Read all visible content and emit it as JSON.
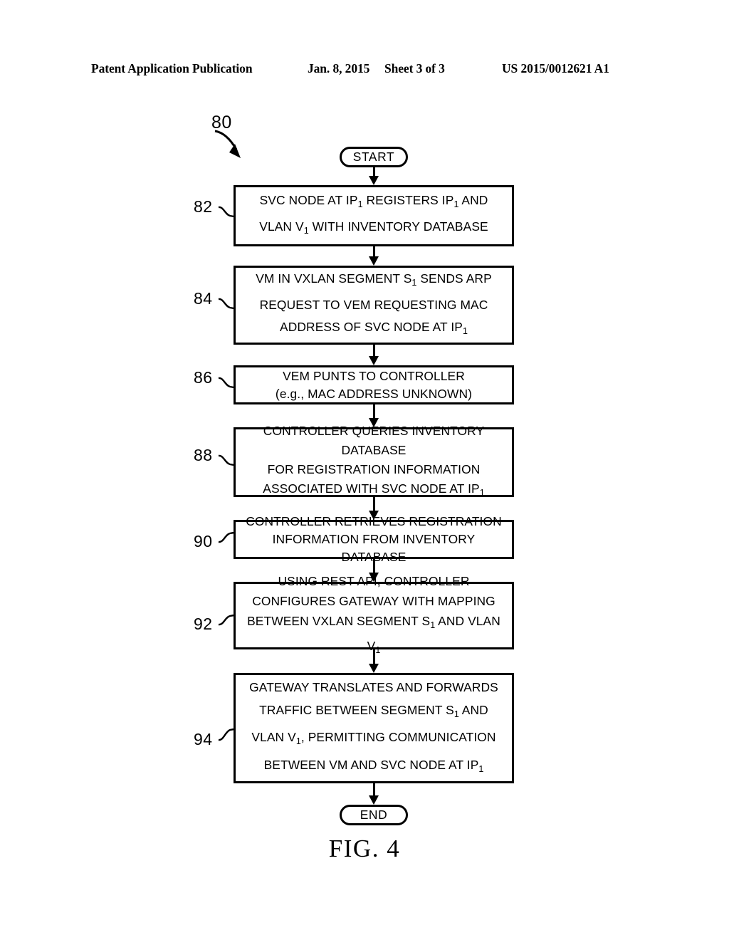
{
  "header": {
    "publication": "Patent Application Publication",
    "date": "Jan. 8, 2015",
    "sheet": "Sheet 3 of 3",
    "patent_number": "US 2015/0012621 A1"
  },
  "figure": {
    "caption": "FIG. 4",
    "reference_numeral": "80"
  },
  "flowchart": {
    "start_label": "START",
    "end_label": "END",
    "steps": [
      {
        "ref": "82",
        "lines": [
          "SVC NODE AT IP<sub>1</sub> REGISTERS IP<sub>1</sub> AND",
          "VLAN V<sub>1</sub> WITH INVENTORY DATABASE"
        ],
        "text": "SVC NODE AT IP1 REGISTERS IP1 AND VLAN V1 WITH INVENTORY DATABASE"
      },
      {
        "ref": "84",
        "lines": [
          "VM IN VXLAN SEGMENT S<sub>1</sub> SENDS ARP",
          "REQUEST TO VEM REQUESTING MAC",
          "ADDRESS OF SVC NODE AT IP<sub>1</sub>"
        ],
        "text": "VM IN VXLAN SEGMENT S1 SENDS ARP REQUEST TO VEM REQUESTING MAC ADDRESS OF SVC NODE AT IP1"
      },
      {
        "ref": "86",
        "lines": [
          "VEM PUNTS TO CONTROLLER",
          "(e.g., MAC ADDRESS UNKNOWN)"
        ],
        "text": "VEM PUNTS TO CONTROLLER (e.g., MAC ADDRESS UNKNOWN)"
      },
      {
        "ref": "88",
        "lines": [
          "CONTROLLER QUERIES INVENTORY DATABASE",
          "FOR REGISTRATION INFORMATION",
          "ASSOCIATED WITH SVC NODE AT IP<sub>1</sub>"
        ],
        "text": "CONTROLLER QUERIES INVENTORY DATABASE FOR REGISTRATION INFORMATION ASSOCIATED WITH SVC NODE AT IP1"
      },
      {
        "ref": "90",
        "lines": [
          "CONTROLLER RETRIEVES REGISTRATION",
          "INFORMATION FROM INVENTORY DATABASE"
        ],
        "text": "CONTROLLER RETRIEVES REGISTRATION INFORMATION FROM INVENTORY DATABASE"
      },
      {
        "ref": "92",
        "lines": [
          "USING REST API, CONTROLLER",
          "CONFIGURES GATEWAY WITH MAPPING",
          "BETWEEN VXLAN SEGMENT S<sub>1</sub> AND VLAN V<sub>1</sub>"
        ],
        "text": "USING REST API, CONTROLLER CONFIGURES GATEWAY WITH MAPPING BETWEEN VXLAN SEGMENT S1 AND VLAN V1"
      },
      {
        "ref": "94",
        "lines": [
          "GATEWAY TRANSLATES AND FORWARDS",
          "TRAFFIC BETWEEN SEGMENT S<sub>1</sub> AND",
          "VLAN V<sub>1</sub>, PERMITTING COMMUNICATION",
          "BETWEEN VM AND SVC NODE AT IP<sub>1</sub>"
        ],
        "text": "GATEWAY TRANSLATES AND FORWARDS TRAFFIC BETWEEN SEGMENT S1 AND VLAN V1, PERMITTING COMMUNICATION BETWEEN VM AND SVC NODE AT IP1"
      }
    ]
  },
  "colors": {
    "ink": "#000000",
    "paper": "#ffffff"
  }
}
